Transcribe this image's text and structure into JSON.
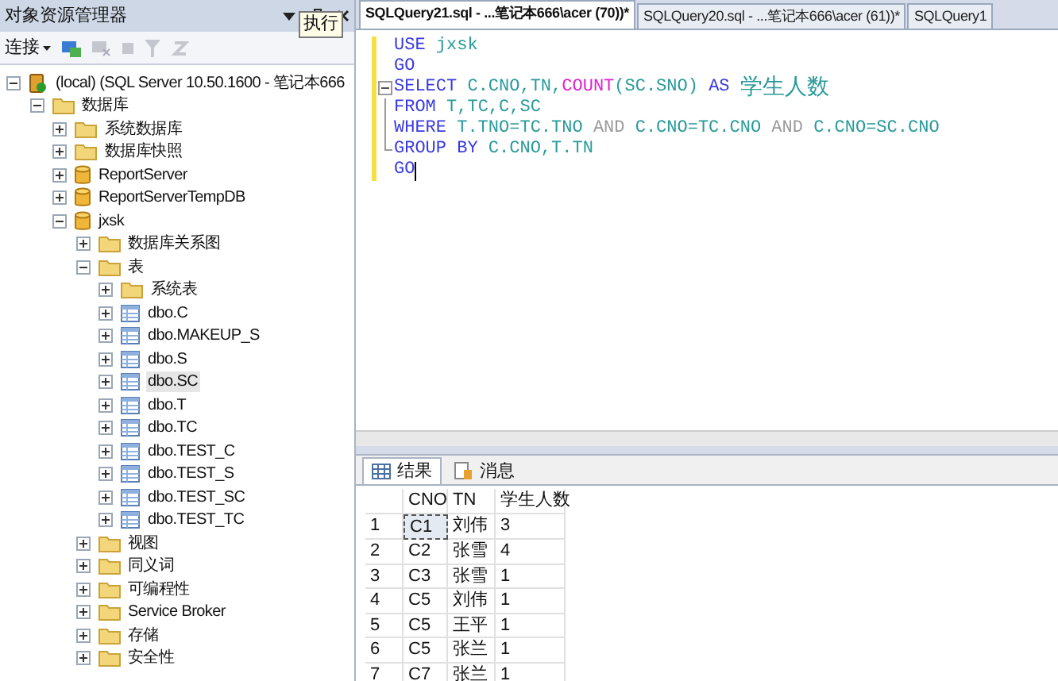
{
  "explorer": {
    "title": "对象资源管理器",
    "tooltip": "执行",
    "toolbar": {
      "connect": "连接"
    },
    "tree": [
      {
        "label": "(local) (SQL Server 10.50.1600 - 笔记本666",
        "kind": "server",
        "expanded": true,
        "selected": false,
        "children": [
          {
            "label": "数据库",
            "kind": "folder",
            "expanded": true,
            "selected": false,
            "children": [
              {
                "label": "系统数据库",
                "kind": "folder",
                "expanded": false,
                "selected": false
              },
              {
                "label": "数据库快照",
                "kind": "folder",
                "expanded": false,
                "selected": false
              },
              {
                "label": "ReportServer",
                "kind": "database",
                "expanded": false,
                "selected": false
              },
              {
                "label": "ReportServerTempDB",
                "kind": "database",
                "expanded": false,
                "selected": false
              },
              {
                "label": "jxsk",
                "kind": "database",
                "expanded": true,
                "selected": false,
                "children": [
                  {
                    "label": "数据库关系图",
                    "kind": "folder",
                    "expanded": false,
                    "selected": false
                  },
                  {
                    "label": "表",
                    "kind": "folder",
                    "expanded": true,
                    "selected": false,
                    "children": [
                      {
                        "label": "系统表",
                        "kind": "folder",
                        "expanded": false,
                        "selected": false
                      },
                      {
                        "label": "dbo.C",
                        "kind": "table",
                        "expanded": false,
                        "selected": false
                      },
                      {
                        "label": "dbo.MAKEUP_S",
                        "kind": "table",
                        "expanded": false,
                        "selected": false
                      },
                      {
                        "label": "dbo.S",
                        "kind": "table",
                        "expanded": false,
                        "selected": false
                      },
                      {
                        "label": "dbo.SC",
                        "kind": "table",
                        "expanded": false,
                        "selected": true
                      },
                      {
                        "label": "dbo.T",
                        "kind": "table",
                        "expanded": false,
                        "selected": false
                      },
                      {
                        "label": "dbo.TC",
                        "kind": "table",
                        "expanded": false,
                        "selected": false
                      },
                      {
                        "label": "dbo.TEST_C",
                        "kind": "table",
                        "expanded": false,
                        "selected": false
                      },
                      {
                        "label": "dbo.TEST_S",
                        "kind": "table",
                        "expanded": false,
                        "selected": false
                      },
                      {
                        "label": "dbo.TEST_SC",
                        "kind": "table",
                        "expanded": false,
                        "selected": false
                      },
                      {
                        "label": "dbo.TEST_TC",
                        "kind": "table",
                        "expanded": false,
                        "selected": false
                      }
                    ]
                  },
                  {
                    "label": "视图",
                    "kind": "folder",
                    "expanded": false,
                    "selected": false
                  },
                  {
                    "label": "同义词",
                    "kind": "folder",
                    "expanded": false,
                    "selected": false
                  },
                  {
                    "label": "可编程性",
                    "kind": "folder",
                    "expanded": false,
                    "selected": false
                  },
                  {
                    "label": "Service Broker",
                    "kind": "folder",
                    "expanded": false,
                    "selected": false
                  },
                  {
                    "label": "存储",
                    "kind": "folder",
                    "expanded": false,
                    "selected": false
                  },
                  {
                    "label": "安全性",
                    "kind": "folder",
                    "expanded": false,
                    "selected": false
                  }
                ]
              }
            ]
          }
        ]
      }
    ]
  },
  "tabs": [
    {
      "label": "SQLQuery21.sql - ...笔记本666\\acer (70))*",
      "selected": true
    },
    {
      "label": "SQLQuery20.sql - ...笔记本666\\acer (61))*",
      "selected": false
    },
    {
      "label": "SQLQuery1",
      "selected": false
    }
  ],
  "editor": {
    "lines": [
      [
        {
          "text": "USE ",
          "kind": "keyword"
        },
        {
          "text": "jxsk",
          "kind": "ident"
        }
      ],
      [
        {
          "text": "GO",
          "kind": "keyword"
        }
      ],
      [
        {
          "text": "SELECT ",
          "kind": "keyword"
        },
        {
          "text": "C.CNO,TN,",
          "kind": "ident"
        },
        {
          "text": "COUNT",
          "kind": "function"
        },
        {
          "text": "(SC.SNO) ",
          "kind": "ident"
        },
        {
          "text": "AS ",
          "kind": "keyword"
        },
        {
          "text": "学生人数",
          "kind": "cjk"
        }
      ],
      [
        {
          "text": "FROM ",
          "kind": "keyword"
        },
        {
          "text": "T,TC,C,SC",
          "kind": "ident"
        }
      ],
      [
        {
          "text": "WHERE ",
          "kind": "keyword"
        },
        {
          "text": "T.TNO=TC.TNO ",
          "kind": "ident"
        },
        {
          "text": "AND ",
          "kind": "operator"
        },
        {
          "text": "C.CNO=TC.CNO ",
          "kind": "ident"
        },
        {
          "text": "AND ",
          "kind": "operator"
        },
        {
          "text": "C.CNO=SC.CNO",
          "kind": "ident"
        }
      ],
      [
        {
          "text": "GROUP BY ",
          "kind": "keyword"
        },
        {
          "text": "C.CNO,T.TN",
          "kind": "ident"
        }
      ],
      [
        {
          "text": "GO",
          "kind": "keyword"
        }
      ]
    ]
  },
  "results": {
    "tabs": [
      {
        "label": "结果",
        "selected": true
      },
      {
        "label": "消息",
        "selected": false
      }
    ],
    "columns": [
      "CNO",
      "TN",
      "学生人数"
    ],
    "rows": [
      {
        "num": "1",
        "cells": [
          {
            "text": "C1",
            "selected": true
          },
          {
            "text": "刘伟",
            "selected": false
          },
          {
            "text": "3",
            "selected": false
          }
        ]
      },
      {
        "num": "2",
        "cells": [
          {
            "text": "C2",
            "selected": false
          },
          {
            "text": "张雪",
            "selected": false
          },
          {
            "text": "4",
            "selected": false
          }
        ]
      },
      {
        "num": "3",
        "cells": [
          {
            "text": "C3",
            "selected": false
          },
          {
            "text": "张雪",
            "selected": false
          },
          {
            "text": "1",
            "selected": false
          }
        ]
      },
      {
        "num": "4",
        "cells": [
          {
            "text": "C5",
            "selected": false
          },
          {
            "text": "刘伟",
            "selected": false
          },
          {
            "text": "1",
            "selected": false
          }
        ]
      },
      {
        "num": "5",
        "cells": [
          {
            "text": "C5",
            "selected": false
          },
          {
            "text": "王平",
            "selected": false
          },
          {
            "text": "1",
            "selected": false
          }
        ]
      },
      {
        "num": "6",
        "cells": [
          {
            "text": "C5",
            "selected": false
          },
          {
            "text": "张兰",
            "selected": false
          },
          {
            "text": "1",
            "selected": false
          }
        ]
      },
      {
        "num": "7",
        "cells": [
          {
            "text": "C7",
            "selected": false
          },
          {
            "text": "张兰",
            "selected": false
          },
          {
            "text": "1",
            "selected": false
          }
        ]
      }
    ]
  }
}
